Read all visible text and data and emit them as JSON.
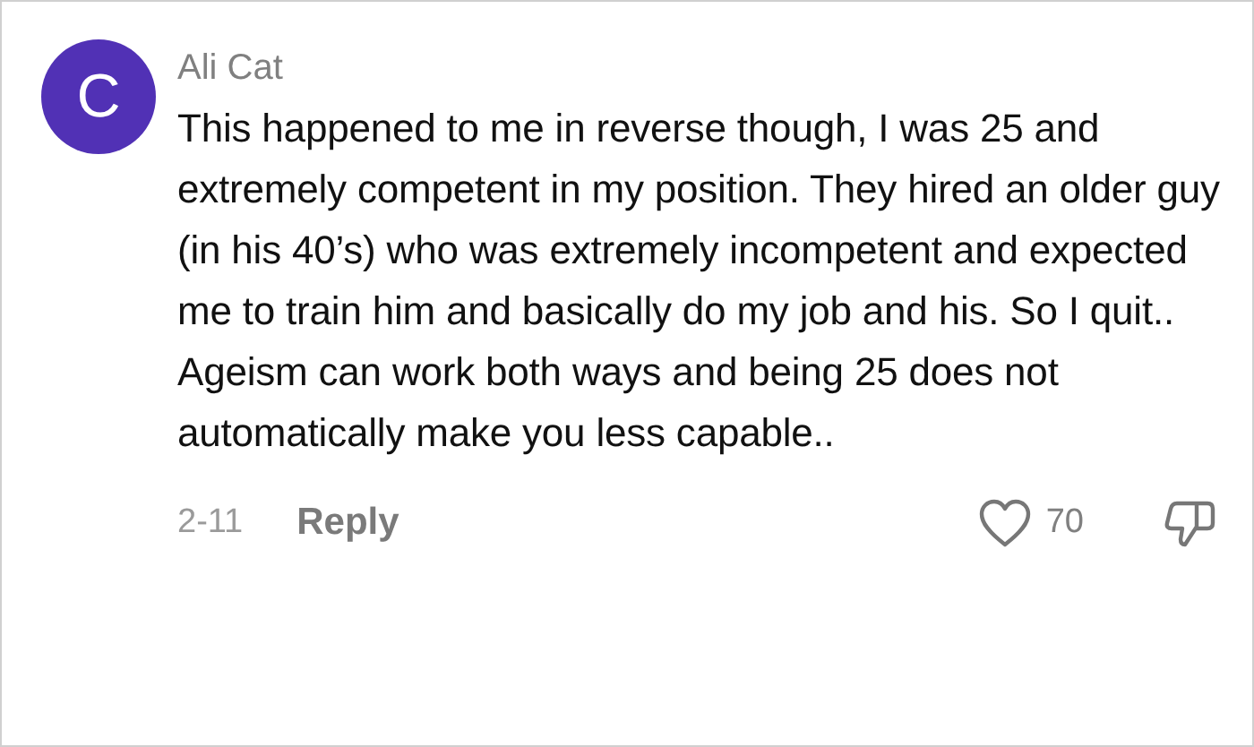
{
  "comment": {
    "avatar_letter": "C",
    "author": "Ali Cat",
    "text": "This happened to me in reverse though, I was 25 and extremely competent in my position. They hired an older guy (in his 40’s) who was extremely incompetent and expected me to train him and basically do my job and his. So I quit.. Ageism can work both ways and being 25 does not automatically make you less capable..",
    "date": "2-11",
    "reply": "Reply",
    "likes": "70"
  }
}
